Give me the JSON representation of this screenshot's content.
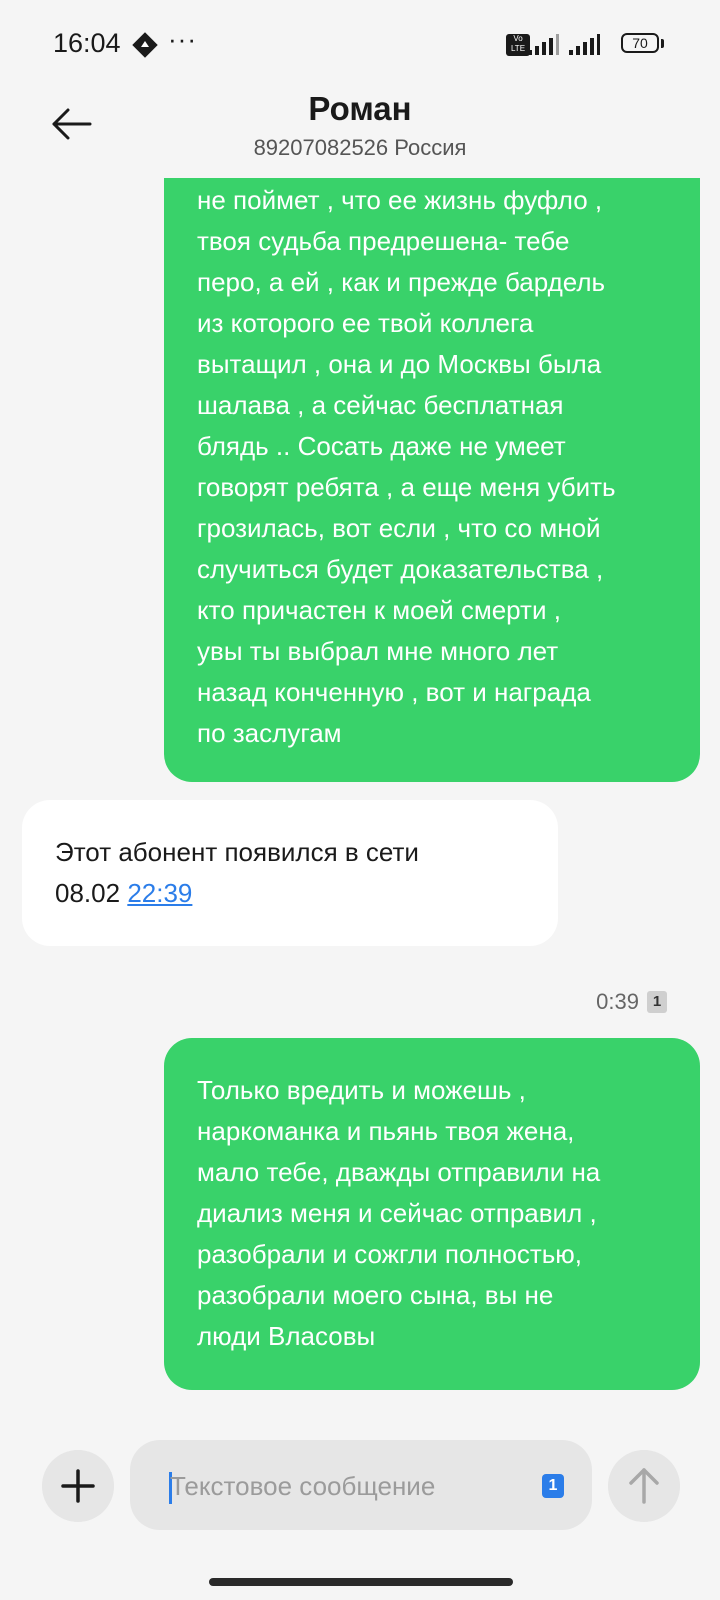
{
  "status_bar": {
    "time": "16:04",
    "more": "···",
    "volte_label": "Vo LTE",
    "battery_level": "70",
    "icons": [
      "navigation-icon",
      "volte-icon",
      "signal-icon",
      "signal-icon",
      "battery-icon"
    ]
  },
  "header": {
    "contact_name": "Роман",
    "contact_number": "89207082526 Россия",
    "back_icon": "arrow-left-icon"
  },
  "messages": [
    {
      "direction": "outgoing",
      "lines": [
        "не поймет , что ее жизнь фуфло ,",
        "твоя судьба предрешена- тебе",
        "перо, а ей , как и прежде бардель",
        "из которого ее твой коллега",
        "вытащил , она и до Москвы была",
        "шалава , а сейчас бесплатная",
        "блядь .. Сосать даже не умеет",
        "говорят ребята , а еще меня убить",
        "грозилась, вот если , что со мной",
        "случиться будет доказательства ,",
        "кто причастен к моей смерти ,",
        "увы ты выбрал мне много лет",
        "назад конченную , вот и награда",
        "по заслугам"
      ]
    },
    {
      "direction": "incoming",
      "line1": "Этот абонент появился в сети",
      "date": "08.02",
      "time_link": "22:39"
    },
    {
      "direction": "outgoing",
      "meta_time": "0:39",
      "meta_sim": "1",
      "lines": [
        "Только вредить и можешь ,",
        "наркоманка и пьянь твоя жена,",
        "мало тебе, дважды отправили на",
        "диализ меня и сейчас отправил ,",
        "разобрали и сожгли полностью,",
        "разобрали моего сына, вы не",
        "люди Власовы"
      ]
    }
  ],
  "composer": {
    "placeholder": "Текстовое сообщение",
    "sim_label": "1",
    "attach_icon": "plus-icon",
    "send_icon": "arrow-up-icon"
  },
  "colors": {
    "outgoing_bubble": "#39d26a",
    "incoming_bubble": "#ffffff",
    "background": "#f5f5f5",
    "accent": "#2b7de9"
  }
}
